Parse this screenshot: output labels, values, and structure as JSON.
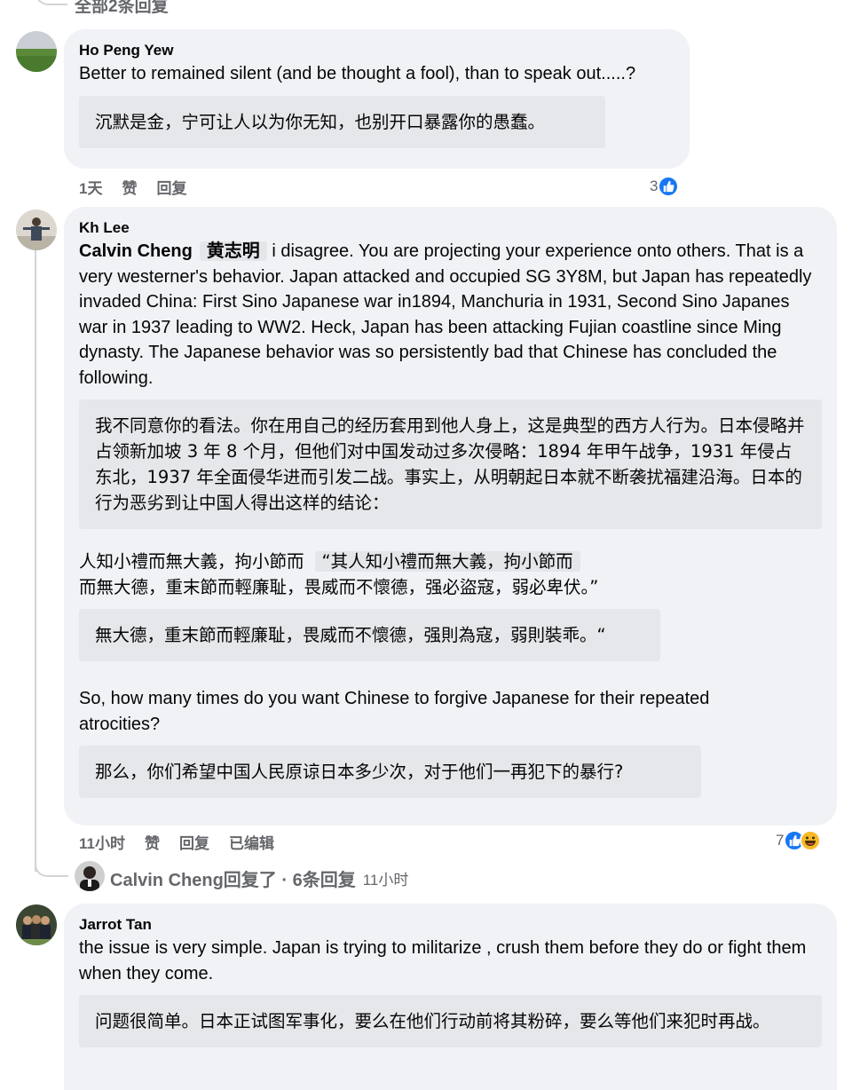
{
  "top": {
    "replies_link": "全部2条回复"
  },
  "comments": [
    {
      "author": "Ho Peng Yew",
      "text": "Better to remained silent (and be thought a fool), than to speak out.....?",
      "translation": "沉默是金，宁可让人以为你无知，也别开口暴露你的愚蠢。",
      "meta": {
        "time": "1天",
        "like": "赞",
        "reply": "回复"
      },
      "reaction_count": "3"
    },
    {
      "author": "Kh Lee",
      "mention1": "Calvin Cheng",
      "mention2": "黄志明",
      "text1": "i disagree. You are projecting your experience onto others. That is a very westerner's behavior. Japan attacked and occupied SG 3Y8M, but Japan has repeatedly invaded China: First Sino Japanese war in1894, Manchuria in 1931, Second Sino Japanes war in 1937 leading to WW2. Heck, Japan has been attacking Fujian coastline since Ming dynasty. The Japanese behavior was so persistently bad that Chinese has concluded the following.",
      "translation1": "我不同意你的看法。你在用自己的经历套用到他人身上，这是典型的西方人行为。日本侵略并占领新加坡 3 年 8 个月，但他们对中国发动过多次侵略：1894 年甲午战争，1931 年侵占东北，1937 年全面侵华进而引发二战。事实上，从明朝起日本就不断袭扰福建沿海。日本的行为恶劣到让中国人得出这样的结论：",
      "quote_line1": "人知小禮而無大義，拘小節而",
      "quote_tag": "“其人知小禮而無大義，拘小節而",
      "quote_line2": "而無大德，重末節而輕廉耻，畏威而不懷德，强必盜寇，弱必卑伏。”",
      "translation2": "無大德，重末節而輕廉耻，畏威而不懷德，强則為寇，弱則裝乖。“",
      "text2": "So, how many times do you want Chinese to forgive Japanese for their repeated atrocities?",
      "translation3": "那么，你们希望中国人民原谅日本多少次，对于他们一再犯下的暴行?",
      "meta": {
        "time": "11小时",
        "like": "赞",
        "reply": "回复",
        "edited": "已编辑"
      },
      "reaction_count": "7"
    },
    {
      "author": "Jarrot Tan",
      "text": "the issue is very simple. Japan is trying to militarize , crush them before they do or fight them when they come.",
      "translation": "问题很简单。日本正试图军事化，要么在他们行动前将其粉碎，要么等他们来犯时再战。"
    }
  ],
  "replies_summary": {
    "label": "Calvin Cheng回复了 · 6条回复",
    "time": "11小时"
  },
  "colors": {
    "like_blue": "#1877f2",
    "bubble": "#f0f2f5",
    "translation_box": "#e6e7ea",
    "meta_gray": "#65676b"
  }
}
